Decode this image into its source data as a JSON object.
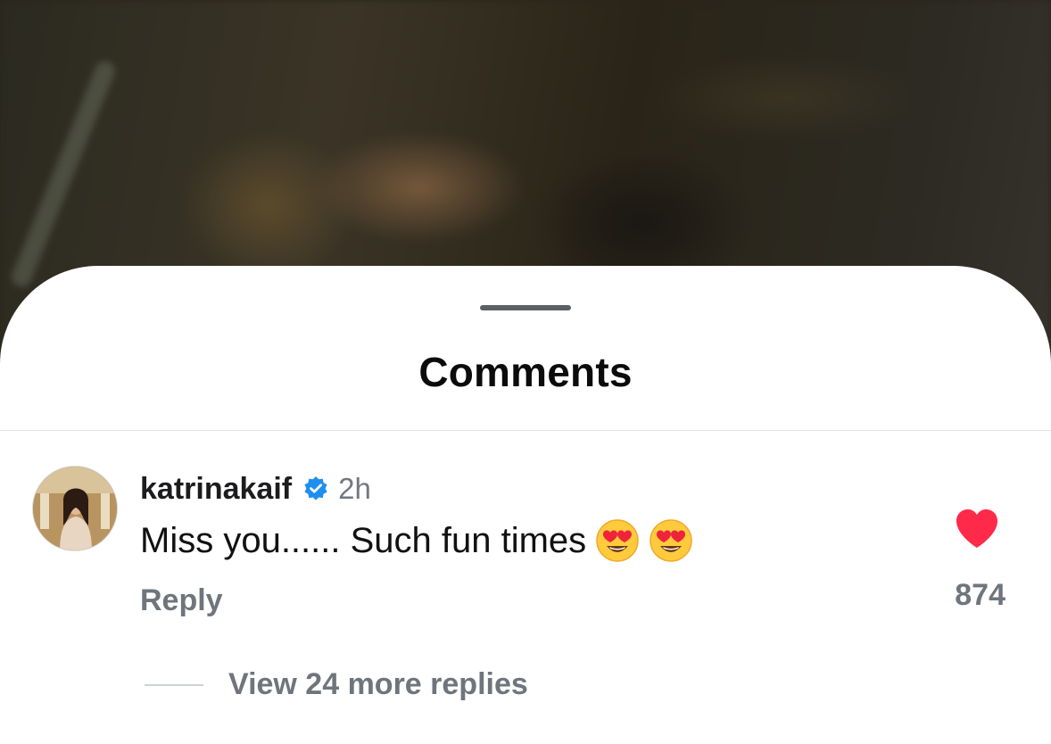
{
  "sheet": {
    "title": "Comments"
  },
  "comment": {
    "username": "katrinakaif",
    "verified": true,
    "timestamp": "2h",
    "text": "Miss you...... Such fun times",
    "emojis": [
      "heart-eyes-emoji",
      "heart-eyes-emoji"
    ],
    "reply_label": "Reply",
    "like_count": "874",
    "liked": true,
    "view_replies_label": "View 24 more replies"
  },
  "colors": {
    "heart": "#ff2a4a",
    "verified_badge": "#1f8ef1",
    "secondary_text": "#6f757d"
  }
}
